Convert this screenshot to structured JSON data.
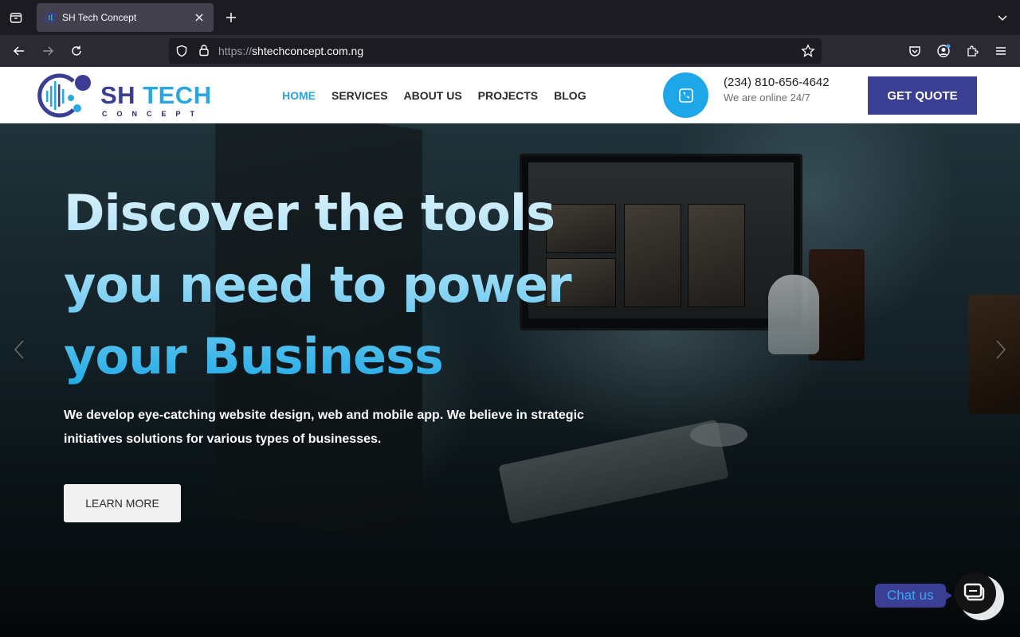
{
  "browser": {
    "tab_title": "SH Tech Concept",
    "url_scheme": "https://",
    "url_host": "shtechconcept.com.ng"
  },
  "header": {
    "logo_main_left": "SH ",
    "logo_main_right": "TECH",
    "logo_sub": "CONCEPT",
    "menu": [
      "HOME",
      "SERVICES",
      "ABOUT US",
      "PROJECTS",
      "BLOG"
    ],
    "active_menu": "HOME",
    "phone": "(234) 810-656-4642",
    "phone_sub": "We are online 24/7",
    "quote_label": "GET QUOTE"
  },
  "hero": {
    "headline": [
      "Discover the tools",
      "you need to power",
      "your Business"
    ],
    "text": "We develop eye-catching website design, web and mobile app. We believe in strategic initiatives solutions for various types of businesses.",
    "cta_label": "LEARN MORE"
  },
  "chat": {
    "label": "Chat us"
  },
  "colors": {
    "brand_navy": "#3a3f93",
    "brand_blue": "#29a8e0",
    "phone_circle": "#1ea7e8"
  }
}
